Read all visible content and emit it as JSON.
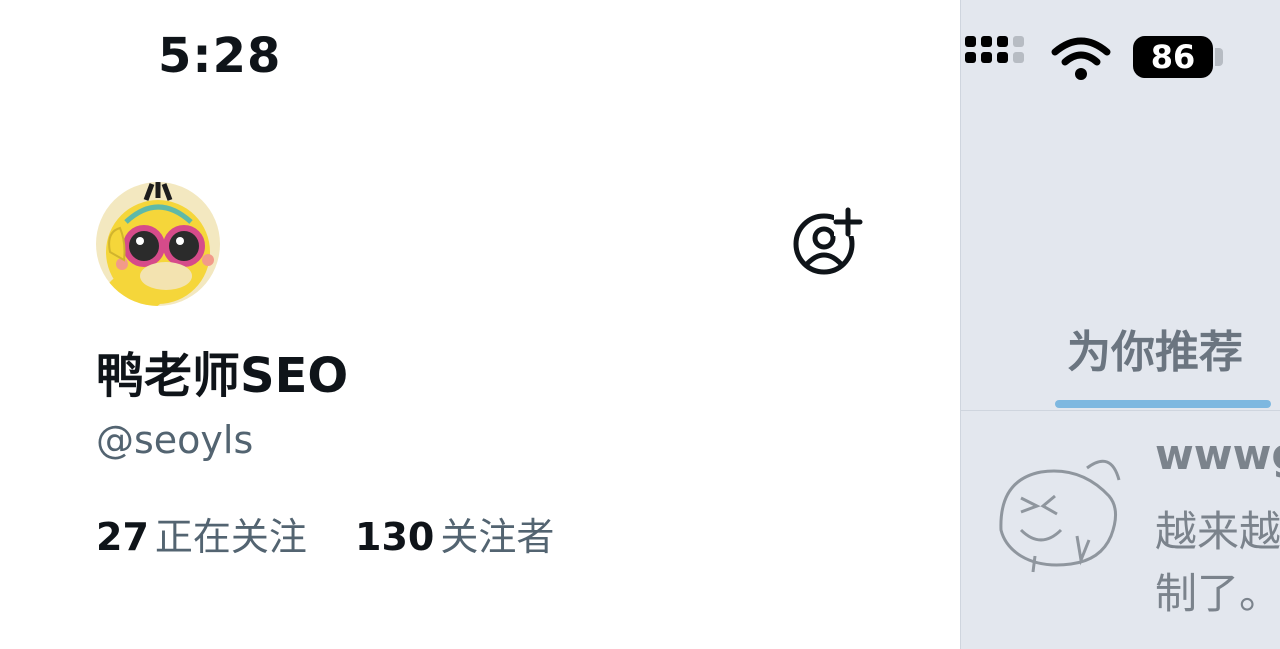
{
  "status_bar": {
    "time": "5:28",
    "battery": "86"
  },
  "profile": {
    "name": "鸭老师SEO",
    "handle": "@seoyls",
    "following_count": "27",
    "following_label": "正在关注",
    "followers_count": "130",
    "followers_label": "关注者"
  },
  "timeline": {
    "tab_label": "为你推荐",
    "tweet": {
      "author": "wwwg",
      "line1": "越来越",
      "line2": "制了。"
    }
  },
  "icons": {
    "add_account": "add-account-icon",
    "wifi": "wifi-icon",
    "signal": "cellular-signal-icon",
    "battery": "battery-icon"
  },
  "colors": {
    "text_primary": "#0f1419",
    "text_secondary": "#536471",
    "tab_indicator": "#7eb8e0",
    "dim_background": "#e3e7ee"
  }
}
